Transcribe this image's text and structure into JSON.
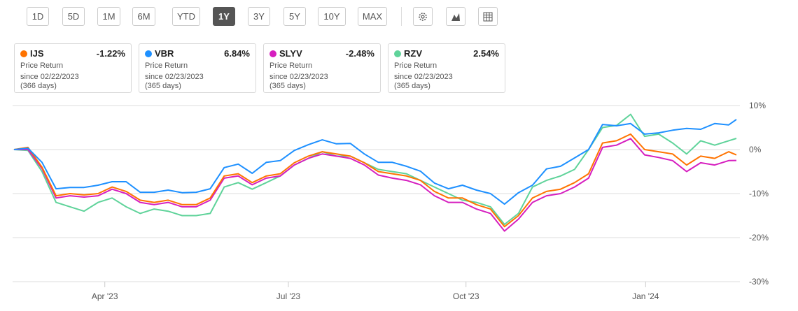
{
  "ranges": [
    {
      "label": "1D",
      "active": false
    },
    {
      "label": "5D",
      "active": false
    },
    {
      "label": "1M",
      "active": false
    },
    {
      "label": "6M",
      "active": false
    },
    {
      "label": "YTD",
      "active": false
    },
    {
      "label": "1Y",
      "active": true
    },
    {
      "label": "3Y",
      "active": false
    },
    {
      "label": "5Y",
      "active": false
    },
    {
      "label": "10Y",
      "active": false
    },
    {
      "label": "MAX",
      "active": false
    }
  ],
  "tools": [
    "gear-icon",
    "mountain-chart-icon",
    "table-icon"
  ],
  "cards": [
    {
      "ticker": "IJS",
      "value": "-1.22%",
      "type": "Price Return",
      "since": "since 02/22/2023",
      "days": "(366 days)",
      "color": "#ff7300"
    },
    {
      "ticker": "VBR",
      "value": "6.84%",
      "type": "Price Return",
      "since": "since 02/23/2023",
      "days": "(365 days)",
      "color": "#1e90ff"
    },
    {
      "ticker": "SLYV",
      "value": "-2.48%",
      "type": "Price Return",
      "since": "since 02/23/2023",
      "days": "(365 days)",
      "color": "#d61fbf"
    },
    {
      "ticker": "RZV",
      "value": "2.54%",
      "type": "Price Return",
      "since": "since 02/23/2023",
      "days": "(365 days)",
      "color": "#5fd39a"
    }
  ],
  "chart_data": {
    "type": "line",
    "xlabel": "",
    "ylabel": "",
    "ylim": [
      -30,
      10
    ],
    "xlim_days": [
      0,
      366
    ],
    "y_ticks": [
      {
        "v": 10,
        "label": "10%"
      },
      {
        "v": 0,
        "label": "0%"
      },
      {
        "v": -10,
        "label": "-10%"
      },
      {
        "v": -20,
        "label": "-20%"
      },
      {
        "v": -30,
        "label": "-30%"
      }
    ],
    "x_ticks": [
      {
        "day": 46,
        "label": "Apr '23"
      },
      {
        "day": 139,
        "label": "Jul '23"
      },
      {
        "day": 229,
        "label": "Oct '23"
      },
      {
        "day": 320,
        "label": "Jan '24"
      }
    ],
    "x_step_days": 7.1,
    "series": [
      {
        "name": "RZV",
        "color": "#5fd39a",
        "values": [
          0,
          -0.2,
          -5,
          -12,
          -13,
          -14,
          -12,
          -11,
          -13,
          -14.5,
          -13.5,
          -14,
          -15,
          -15,
          -14.5,
          -8.5,
          -7.5,
          -9,
          -7.5,
          -6,
          -3.5,
          -2,
          -0.5,
          -1.5,
          -1.5,
          -3,
          -4.5,
          -5,
          -5.5,
          -7,
          -8.5,
          -10,
          -11.5,
          -12,
          -13,
          -17,
          -14.5,
          -8.5,
          -7,
          -6,
          -4.5,
          0,
          5,
          5.5,
          8,
          3,
          3.5,
          1.5,
          -1,
          2,
          1,
          2,
          2.54
        ]
      },
      {
        "name": "SLYV",
        "color": "#d61fbf",
        "values": [
          0,
          0,
          -4.3,
          -11,
          -10.5,
          -10.8,
          -10.5,
          -9,
          -10,
          -12,
          -12.5,
          -12,
          -13,
          -13,
          -11.5,
          -6.5,
          -6,
          -8,
          -6.5,
          -6,
          -3.5,
          -2,
          -1,
          -1.5,
          -2,
          -3.5,
          -5.8,
          -6.5,
          -7,
          -8,
          -10.5,
          -12,
          -12,
          -13.5,
          -14.5,
          -18.5,
          -15.8,
          -12,
          -10.5,
          -10,
          -8.5,
          -6.5,
          0.5,
          1,
          2.5,
          -1.2,
          -1.8,
          -2.5,
          -5,
          -3,
          -3.5,
          -2.5,
          -2.48
        ]
      },
      {
        "name": "IJS",
        "color": "#ff7300",
        "values": [
          0,
          0.5,
          -4,
          -10.5,
          -10,
          -10.3,
          -10,
          -8.5,
          -9.5,
          -11.5,
          -12,
          -11.5,
          -12.5,
          -12.5,
          -11,
          -6,
          -5.5,
          -7.5,
          -6,
          -5.5,
          -3,
          -1.5,
          -0.5,
          -1,
          -1.5,
          -3,
          -5,
          -5.5,
          -6,
          -7,
          -9.5,
          -11,
          -11,
          -12.5,
          -13.5,
          -17.5,
          -15,
          -11,
          -9.5,
          -9,
          -7.5,
          -5.5,
          1.5,
          2,
          3.5,
          0,
          -0.5,
          -1,
          -3.5,
          -1.5,
          -2,
          -0.5,
          -1.22
        ]
      },
      {
        "name": "VBR",
        "color": "#1e90ff",
        "values": [
          0,
          0.3,
          -2.9,
          -8.9,
          -8.6,
          -8.6,
          -8.1,
          -7.3,
          -7.3,
          -9.7,
          -9.7,
          -9.2,
          -9.8,
          -9.7,
          -8.9,
          -4.1,
          -3.3,
          -5.4,
          -2.9,
          -2.5,
          -0.2,
          1.1,
          2.2,
          1.3,
          1.4,
          -1.0,
          -2.9,
          -2.9,
          -3.8,
          -4.9,
          -7.6,
          -8.9,
          -8.1,
          -9.2,
          -10.0,
          -12.4,
          -9.8,
          -8.1,
          -4.4,
          -3.8,
          -1.9,
          0,
          5.7,
          5.4,
          5.9,
          3.5,
          3.8,
          4.4,
          4.8,
          4.6,
          5.9,
          5.6,
          6.84
        ]
      }
    ]
  }
}
